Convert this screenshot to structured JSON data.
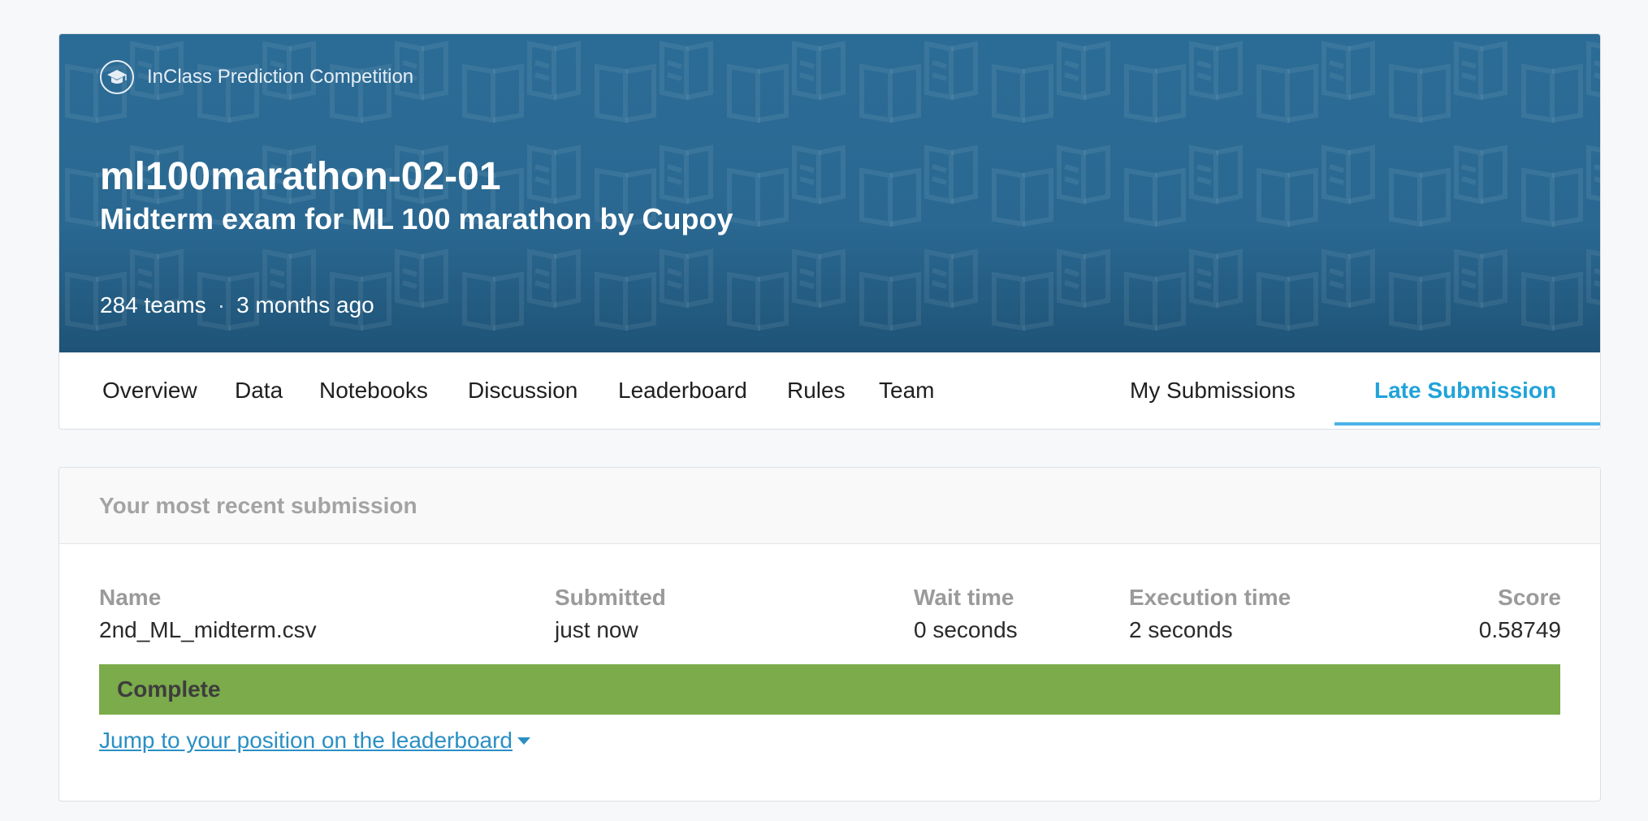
{
  "competition": {
    "type_label": "InClass Prediction Competition",
    "title": "ml100marathon-02-01",
    "subtitle": "Midterm exam for ML 100 marathon by Cupoy",
    "teams": "284 teams",
    "separator": "·",
    "age": "3 months ago"
  },
  "tabs": {
    "overview": "Overview",
    "data": "Data",
    "notebooks": "Notebooks",
    "discussion": "Discussion",
    "leaderboard": "Leaderboard",
    "rules": "Rules",
    "team": "Team",
    "my_submissions": "My Submissions",
    "late_submission": "Late Submission"
  },
  "submission": {
    "header": "Your most recent submission",
    "columns": {
      "name": "Name",
      "submitted": "Submitted",
      "wait_time": "Wait time",
      "execution_time": "Execution time",
      "score": "Score"
    },
    "values": {
      "name": "2nd_ML_midterm.csv",
      "submitted": "just now",
      "wait_time": "0 seconds",
      "execution_time": "2 seconds",
      "score": "0.58749"
    },
    "status": "Complete",
    "jump_link": "Jump to your position on the leaderboard"
  },
  "colors": {
    "banner": "#2a6891",
    "active_tab": "#20a3d9",
    "status_complete": "#7bab4a",
    "link": "#2a8fc4"
  },
  "icons": {
    "competition_type": "graduation-cap-icon",
    "jump_caret": "caret-down-icon",
    "banner_pattern": "open-book-icon"
  }
}
